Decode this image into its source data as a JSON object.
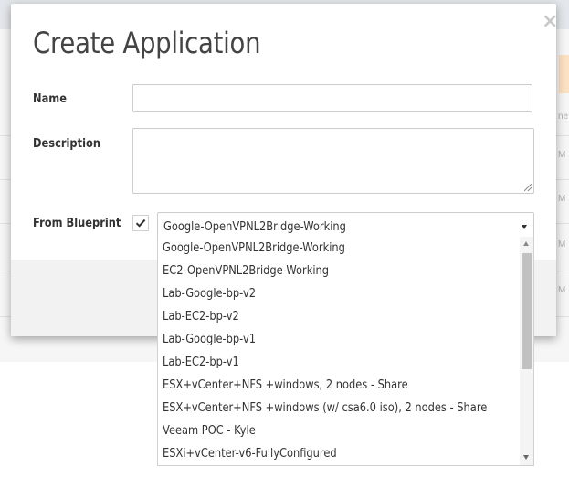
{
  "dialog": {
    "title": "Create Application",
    "close_glyph": "×",
    "close_icon": "close-icon"
  },
  "form": {
    "name_label": "Name",
    "name_value": "",
    "description_label": "Description",
    "description_value": "",
    "blueprint_label": "From Blueprint",
    "blueprint_checked": true,
    "blueprint_selected": "Google-OpenVPNL2Bridge-Working"
  },
  "dropdown": {
    "options": [
      "Google-OpenVPNL2Bridge-Working",
      "EC2-OpenVPNL2Bridge-Working",
      "Lab-Google-bp-v2",
      "Lab-EC2-bp-v2",
      "Lab-Google-bp-v1",
      "Lab-EC2-bp-v1",
      "ESX+vCenter+NFS +windows, 2 nodes - Share",
      "ESX+vCenter+NFS +windows (w/ csa6.0 iso), 2 nodes - Share",
      "Veeam POC - Kyle",
      "ESXi+vCenter-v6-FullyConfigured"
    ]
  },
  "background": {
    "row_fragments": [
      "ne",
      "M",
      "M",
      "M",
      "M"
    ]
  },
  "colors": {
    "overlay_top": "#e3e6ea",
    "footer": "#f2f2f2",
    "accent_orange": "#fbe0c2"
  }
}
